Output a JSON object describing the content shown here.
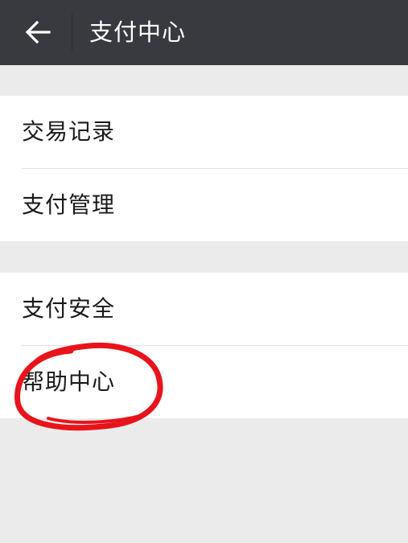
{
  "header": {
    "back_icon": "arrow-left-icon",
    "title": "支付中心"
  },
  "menu_groups": [
    {
      "items": [
        {
          "label": "交易记录"
        },
        {
          "label": "支付管理"
        }
      ]
    },
    {
      "items": [
        {
          "label": "支付安全"
        },
        {
          "label": "帮助中心"
        }
      ]
    }
  ],
  "colors": {
    "header_bg": "#393a3f",
    "page_bg": "#ebebeb",
    "annotation": "#e8131b"
  }
}
